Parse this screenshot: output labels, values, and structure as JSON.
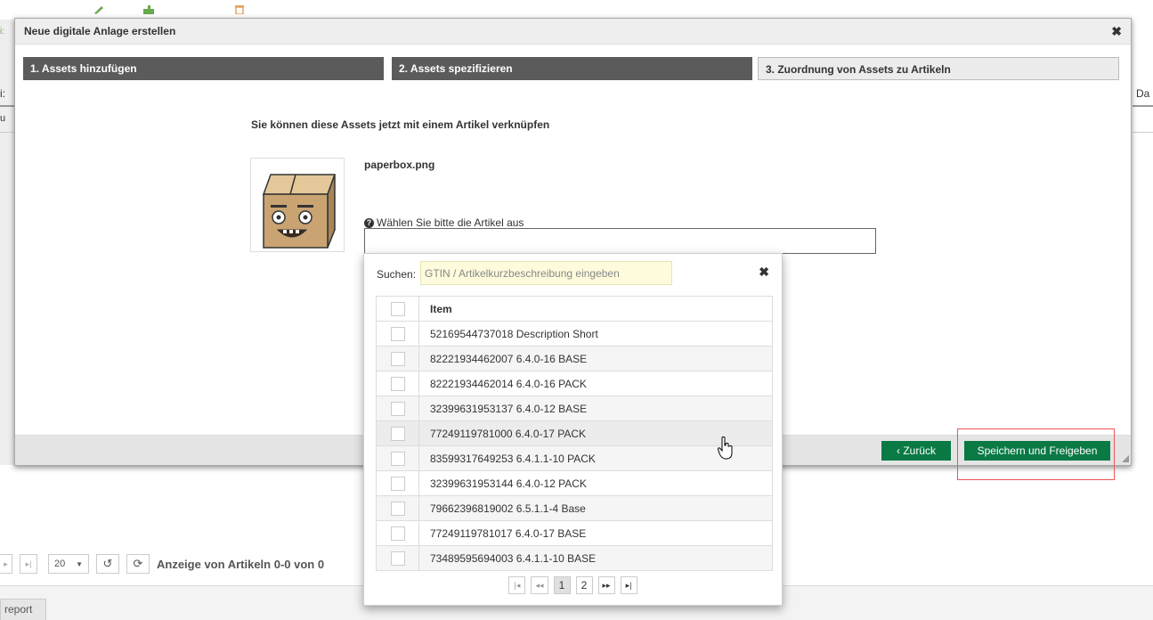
{
  "background": {
    "edge_labels": {
      "left_1": "i:",
      "left_2": "u",
      "right_1": "Da"
    },
    "pager": {
      "page_size": "20",
      "status_text": "Anzeige von Artikeln 0-0 von 0"
    },
    "report_tab": "report"
  },
  "modal": {
    "title": "Neue digitale Anlage erstellen",
    "close_icon": "close-icon",
    "steps": [
      {
        "label": "1. Assets hinzufügen",
        "state": "done"
      },
      {
        "label": "2. Assets spezifizieren",
        "state": "done"
      },
      {
        "label": "3. Zuordnung von Assets zu Artikeln",
        "state": "current"
      }
    ],
    "instruction": "Sie können diese Assets jetzt mit einem Artikel verknüpfen",
    "asset": {
      "filename": "paperbox.png",
      "thumbnail_icon": "paperbox-cartoon-icon"
    },
    "select_label": "Wählen Sie bitte die Artikel aus",
    "footer": {
      "back_label": "‹ Zurück",
      "save_label": "Speichern und Freigeben"
    }
  },
  "popup": {
    "search_label": "Suchen:",
    "search_placeholder": "GTIN / Artikelkurzbeschreibung eingeben",
    "column_header": "Item",
    "items": [
      "52169544737018 Description Short",
      "82221934462007 6.4.0-16 BASE",
      "82221934462014 6.4.0-16 PACK",
      "32399631953137 6.4.0-12 BASE",
      "77249119781000 6.4.0-17 PACK",
      "83599317649253 6.4.1.1-10 PACK",
      "32399631953144 6.4.0-12 PACK",
      "79662396819002 6.5.1.1-4 Base",
      "77249119781017 6.4.0-17 BASE",
      "73489595694003 6.4.1.1-10 BASE"
    ],
    "pager": {
      "first": "|◂",
      "prev": "◂◂",
      "pages": [
        "1",
        "2"
      ],
      "current_page": "1",
      "next": "▸▸",
      "last": "▸|"
    }
  },
  "colors": {
    "accent_green": "#0a7a45",
    "step_done": "#5b5b5b",
    "highlight_red": "#ee5555",
    "search_bg": "#fdfbdc"
  }
}
